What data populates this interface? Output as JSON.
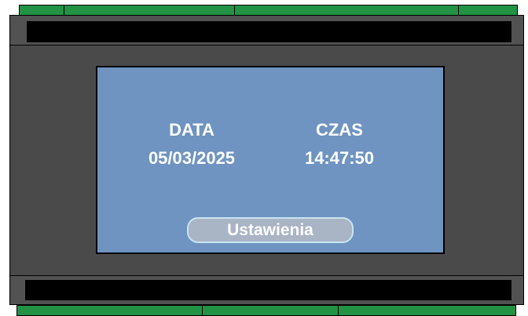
{
  "screen": {
    "date_label": "DATA",
    "date_value": "05/03/2025",
    "time_label": "CZAS",
    "time_value": "14:47:50",
    "settings_button_label": "Ustawienia"
  },
  "colors": {
    "screen_background": "#6f94c1",
    "enclosure": "#4a4a4a",
    "terminal": "#229244",
    "button_background": "#a9b4c4",
    "button_border": "#c9e4f3",
    "text": "#ffffff"
  }
}
